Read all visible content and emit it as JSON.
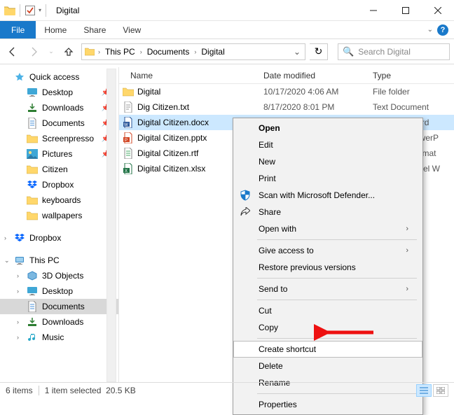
{
  "window": {
    "title": "Digital"
  },
  "ribbon": {
    "file": "File",
    "tabs": [
      "Home",
      "Share",
      "View"
    ]
  },
  "address": {
    "crumbs": [
      "This PC",
      "Documents",
      "Digital"
    ]
  },
  "search": {
    "placeholder": "Search Digital"
  },
  "tree": {
    "quick_access": "Quick access",
    "qa_items": [
      {
        "label": "Desktop",
        "pinned": true,
        "icon": "desktop"
      },
      {
        "label": "Downloads",
        "pinned": true,
        "icon": "downloads"
      },
      {
        "label": "Documents",
        "pinned": true,
        "icon": "documents"
      },
      {
        "label": "Screenpresso",
        "pinned": true,
        "icon": "folder"
      },
      {
        "label": "Pictures",
        "pinned": true,
        "icon": "pictures"
      },
      {
        "label": "Citizen",
        "pinned": false,
        "icon": "folder"
      },
      {
        "label": "Dropbox",
        "pinned": false,
        "icon": "dropbox"
      },
      {
        "label": "keyboards",
        "pinned": false,
        "icon": "folder"
      },
      {
        "label": "wallpapers",
        "pinned": false,
        "icon": "folder"
      }
    ],
    "dropbox": "Dropbox",
    "this_pc": "This PC",
    "pc_items": [
      {
        "label": "3D Objects",
        "icon": "3d"
      },
      {
        "label": "Desktop",
        "icon": "desktop"
      },
      {
        "label": "Documents",
        "icon": "documents",
        "selected": true
      },
      {
        "label": "Downloads",
        "icon": "downloads"
      },
      {
        "label": "Music",
        "icon": "music"
      }
    ]
  },
  "columns": {
    "name": "Name",
    "date": "Date modified",
    "type": "Type"
  },
  "files": [
    {
      "name": "Digital",
      "date": "10/17/2020 4:06 AM",
      "type": "File folder",
      "icon": "folder",
      "selected": false
    },
    {
      "name": "Dig Citizen.txt",
      "date": "8/17/2020 8:01 PM",
      "type": "Text Document",
      "icon": "txt",
      "selected": false
    },
    {
      "name": "Digital Citizen.docx",
      "date": "",
      "type": "Microsoft Word",
      "icon": "docx",
      "selected": true
    },
    {
      "name": "Digital Citizen.pptx",
      "date": "",
      "type": "Microsoft PowerP",
      "icon": "pptx",
      "selected": false
    },
    {
      "name": "Digital Citizen.rtf",
      "date": "",
      "type": "Rich Text Format",
      "icon": "rtf",
      "selected": false
    },
    {
      "name": "Digital Citizen.xlsx",
      "date": "",
      "type": "Microsoft Excel W",
      "icon": "xlsx",
      "selected": false
    }
  ],
  "context_menu": {
    "open": "Open",
    "edit": "Edit",
    "new": "New",
    "print": "Print",
    "scan": "Scan with Microsoft Defender...",
    "share": "Share",
    "open_with": "Open with",
    "give_access": "Give access to",
    "restore": "Restore previous versions",
    "send_to": "Send to",
    "cut": "Cut",
    "copy": "Copy",
    "create_shortcut": "Create shortcut",
    "delete": "Delete",
    "rename": "Rename",
    "properties": "Properties"
  },
  "status": {
    "items": "6 items",
    "selected": "1 item selected",
    "size": "20.5 KB"
  }
}
